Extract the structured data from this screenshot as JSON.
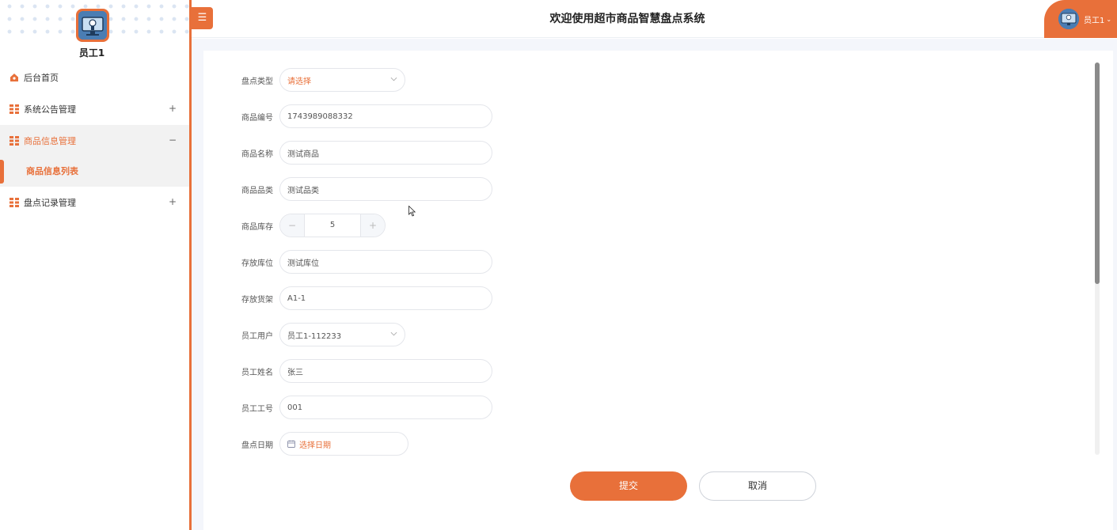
{
  "header": {
    "menu_icon": "hamburger-icon",
    "title": "欢迎使用超市商品智慧盘点系统",
    "user_name": "员工1",
    "caret": "⌄"
  },
  "sidebar": {
    "user_name": "员工1",
    "items": [
      {
        "label": "后台首页",
        "icon": "home-icon",
        "toggle": ""
      },
      {
        "label": "系统公告管理",
        "icon": "grid-icon",
        "toggle": "+"
      },
      {
        "label": "商品信息管理",
        "icon": "grid-icon",
        "toggle": "−"
      },
      {
        "label": "盘点记录管理",
        "icon": "grid-icon",
        "toggle": "+"
      }
    ],
    "sub_items": [
      {
        "label": "商品信息列表"
      }
    ]
  },
  "form": {
    "fields": [
      {
        "label": "盘点类型",
        "value": "请选择"
      },
      {
        "label": "商品编号",
        "value": "1743989088332"
      },
      {
        "label": "商品名称",
        "value": "测试商品"
      },
      {
        "label": "商品品类",
        "value": "测试品类"
      },
      {
        "label": "商品库存",
        "value": "5",
        "minus": "−",
        "plus": "+"
      },
      {
        "label": "存放库位",
        "value": "测试库位"
      },
      {
        "label": "存放货架",
        "value": "A1-1"
      },
      {
        "label": "员工用户",
        "value": "员工1-112233"
      },
      {
        "label": "员工姓名",
        "value": "张三"
      },
      {
        "label": "员工工号",
        "value": "001"
      },
      {
        "label": "盘点日期",
        "value": "选择日期"
      }
    ],
    "submit_label": "提交",
    "cancel_label": "取消"
  },
  "colors": {
    "accent": "#e8703a",
    "active_bg": "#f2f2f2",
    "page_bg": "#f4f6fb"
  }
}
